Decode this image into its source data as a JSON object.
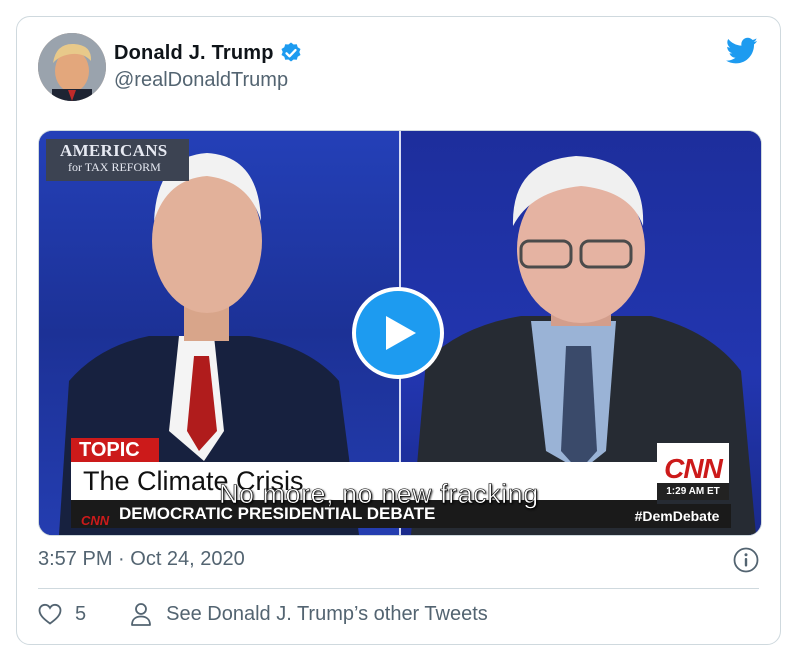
{
  "author": {
    "display_name": "Donald J. Trump",
    "handle": "@realDonaldTrump",
    "verified": true,
    "avatar_icon": "profile-photo"
  },
  "brand_icon": "twitter-bird-icon",
  "media": {
    "type": "video",
    "overlay_logo": {
      "line1": "AMERICANS",
      "line2": "for TAX REFORM"
    },
    "topic_label": "TOPIC",
    "headline": "The Climate Crisis",
    "lower_third": "DEMOCRATIC PRESIDENTIAL DEBATE",
    "network_small": "CNN",
    "network_logo": "CNN",
    "broadcast_time": "1:29 AM ET",
    "hashtag": "#DemDebate",
    "caption": "No more, no new fracking",
    "play_icon": "play-icon"
  },
  "timestamp": "3:57 PM · Oct 24, 2020",
  "footer": {
    "like_count": "5",
    "see_other_label": "See Donald J. Trump’s other Tweets"
  },
  "colors": {
    "accent": "#1d9bf0",
    "text_primary": "#0f1419",
    "text_secondary": "#536471",
    "border": "#cfd9de",
    "cnn_red": "#cc1a1a"
  }
}
